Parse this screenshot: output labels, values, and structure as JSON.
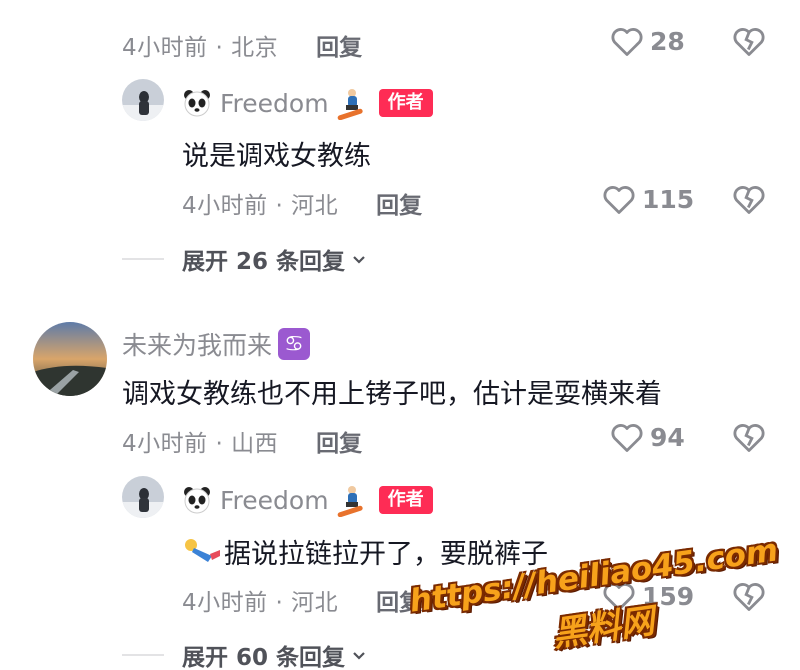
{
  "comments": [
    {
      "meta": {
        "time_location": "4小时前 · 北京",
        "reply": "回复"
      },
      "likes": "28"
    },
    {
      "author": {
        "name": "Freedom",
        "badge": "作者"
      },
      "text": "说是调戏女教练",
      "meta": {
        "time_location": "4小时前 · 河北",
        "reply": "回复"
      },
      "likes": "115"
    },
    {
      "expand": "展开 26 条回复"
    },
    {
      "user": {
        "name": "未来为我而来",
        "zodiac": "♋"
      },
      "text": "调戏女教练也不用上铐子吧，估计是耍横来着",
      "meta": {
        "time_location": "4小时前 · 山西",
        "reply": "回复"
      },
      "likes": "94"
    },
    {
      "author": {
        "name": "Freedom",
        "badge": "作者"
      },
      "text": "据说拉链拉开了，要脱裤子",
      "meta": {
        "time_location": "4小时前 · 河北",
        "reply": "回复"
      },
      "likes": "159"
    },
    {
      "expand": "展开 60 条回复"
    }
  ],
  "watermark": {
    "line1": "https://heiliao45.com",
    "line2": "黑料网"
  },
  "colors": {
    "author_badge": "#fe2c55",
    "watermark": "#f7a21b",
    "meta_gray": "#8a8b91"
  }
}
